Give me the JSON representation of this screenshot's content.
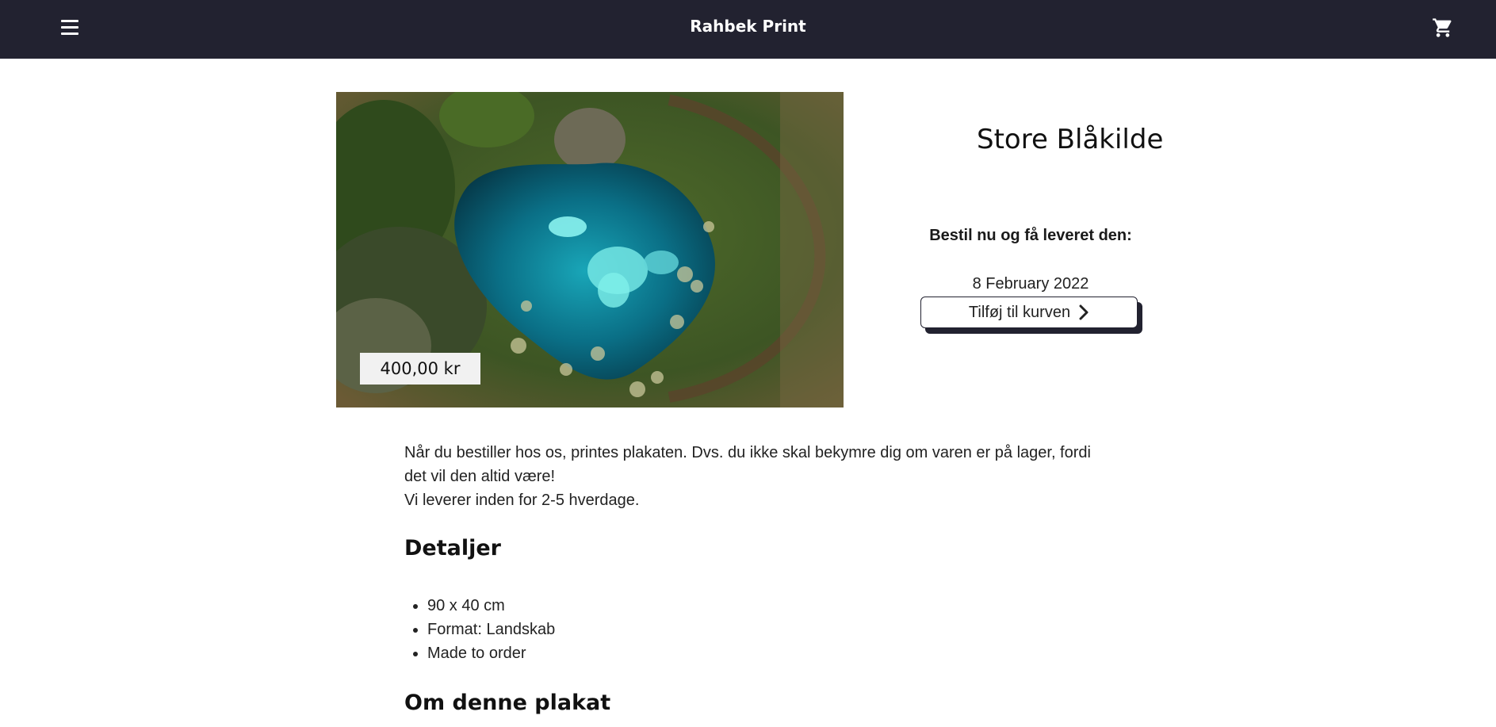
{
  "header": {
    "brand": "Rahbek Print",
    "menu_icon": "hamburger-menu-icon",
    "cart_icon": "shopping-cart-icon",
    "background": "#222230"
  },
  "product": {
    "title": "Store Blåkilde",
    "price": "400,00 kr",
    "image": "aerial-photo-turquoise-spring-icon"
  },
  "order": {
    "label": "Bestil nu og få leveret den:",
    "date": "8 February 2022",
    "add_to_cart": "Tilføj til kurven"
  },
  "description": {
    "line1": "Når du bestiller hos os, printes plakaten. Dvs. du ikke skal bekymre dig om varen er på lager, fordi det vil den altid være!",
    "line2": "Vi leverer inden for 2-5 hverdage."
  },
  "details": {
    "heading": "Detaljer",
    "items": [
      "90 x 40 cm",
      "Format: Landskab",
      "Made to order"
    ]
  },
  "about": {
    "heading": "Om denne plakat"
  }
}
